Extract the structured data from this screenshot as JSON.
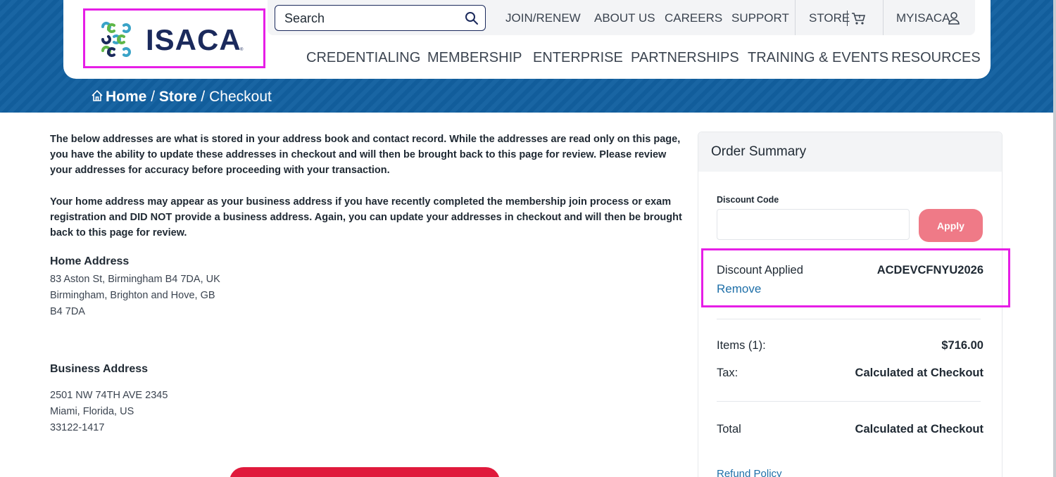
{
  "brand": {
    "logo_text": "ISACA",
    "logo_reg": "®",
    "accent": "#1260a0",
    "navy": "#1b2a5c"
  },
  "search": {
    "placeholder": "Search"
  },
  "utility_nav": {
    "join": "JOIN/RENEW",
    "about": "ABOUT US",
    "careers": "CAREERS",
    "support": "SUPPORT",
    "store": "STORE",
    "myisaca": "MYISACA"
  },
  "main_nav": {
    "credentialing": "CREDENTIALING",
    "membership": "MEMBERSHIP",
    "enterprise": "ENTERPRISE",
    "partnerships": "PARTNERSHIPS",
    "training": "TRAINING & EVENTS",
    "resources": "RESOURCES"
  },
  "breadcrumb": {
    "home": "Home",
    "sep": "/",
    "store": "Store",
    "current": "Checkout"
  },
  "intro": {
    "p1": "The below addresses are what is stored in your address book and contact record. While the addresses are read only on this page, you have the ability to update these addresses in checkout and will then be brought back to this page for review. Please review your addresses for accuracy before proceeding with your transaction.",
    "p2": "Your home address may appear as your business address if you have recently completed the membership join process or exam registration and DID NOT provide a business address. Again, you can update your addresses in checkout and will then be brought back to this page for review."
  },
  "home_address": {
    "heading": "Home Address",
    "line1": "83 Aston St, Birmingham B4 7DA, UK",
    "line2": "Birmingham, Brighton and Hove, GB",
    "line3": "B4 7DA"
  },
  "business_address": {
    "heading": "Business Address",
    "line1": "2501 NW 74TH AVE 2345",
    "line2": "Miami, Florida, US",
    "line3": "33122-1417"
  },
  "order_summary": {
    "title": "Order Summary",
    "discount_label": "Discount Code",
    "discount_value": "",
    "apply": "Apply",
    "applied_label": "Discount Applied",
    "applied_code": "ACDEVCFNYU2026",
    "remove": "Remove",
    "items_label": "Items (1):",
    "items_value": "$716.00",
    "tax_label": "Tax:",
    "tax_value": "Calculated at Checkout",
    "total_label": "Total",
    "total_value": "Calculated at Checkout",
    "refund": "Refund Policy"
  }
}
